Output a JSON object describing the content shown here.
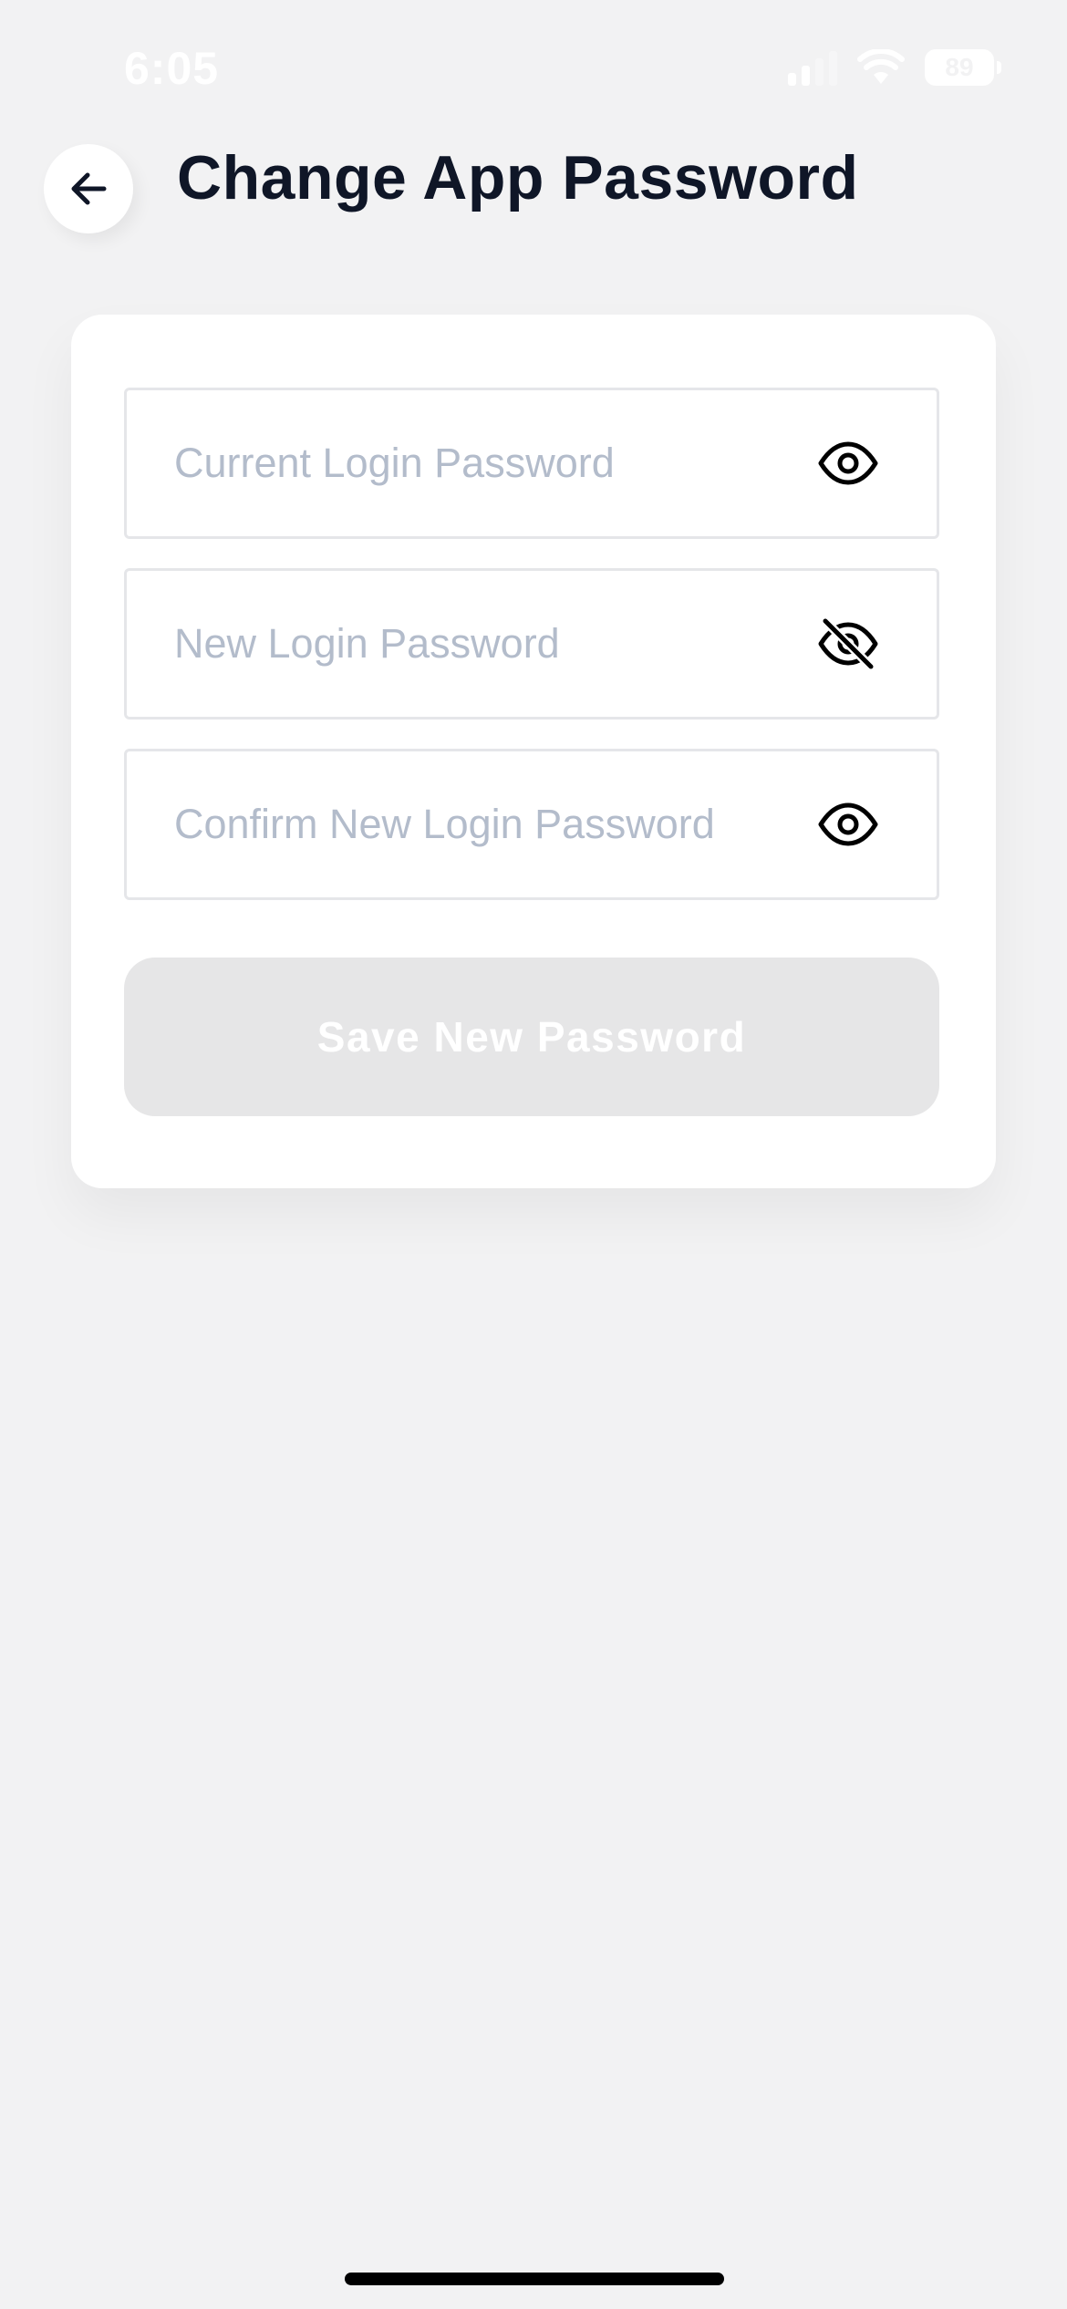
{
  "status_bar": {
    "time": "6:05",
    "battery": "89",
    "icons": [
      "cellular-signal-icon",
      "wifi-icon",
      "battery-icon"
    ]
  },
  "header": {
    "back_icon": "arrow-left-icon",
    "title": "Change App Password"
  },
  "form": {
    "fields": [
      {
        "placeholder": "Current Login Password",
        "value": "",
        "visibility_icon": "eye-icon",
        "password_visible": false
      },
      {
        "placeholder": "New Login Password",
        "value": "",
        "visibility_icon": "eye-off-icon",
        "password_visible": true
      },
      {
        "placeholder": "Confirm New Login Password",
        "value": "",
        "visibility_icon": "eye-icon",
        "password_visible": false
      }
    ],
    "save_button": {
      "label": "Save New Password",
      "enabled": false
    }
  },
  "colors": {
    "background": "#f2f2f3",
    "card": "#ffffff",
    "title_text": "#0f1627",
    "placeholder_text": "#b3bccb",
    "field_border": "#e5e6e9",
    "button_disabled_bg": "#e6e6e7",
    "button_disabled_text": "#ffffff"
  }
}
